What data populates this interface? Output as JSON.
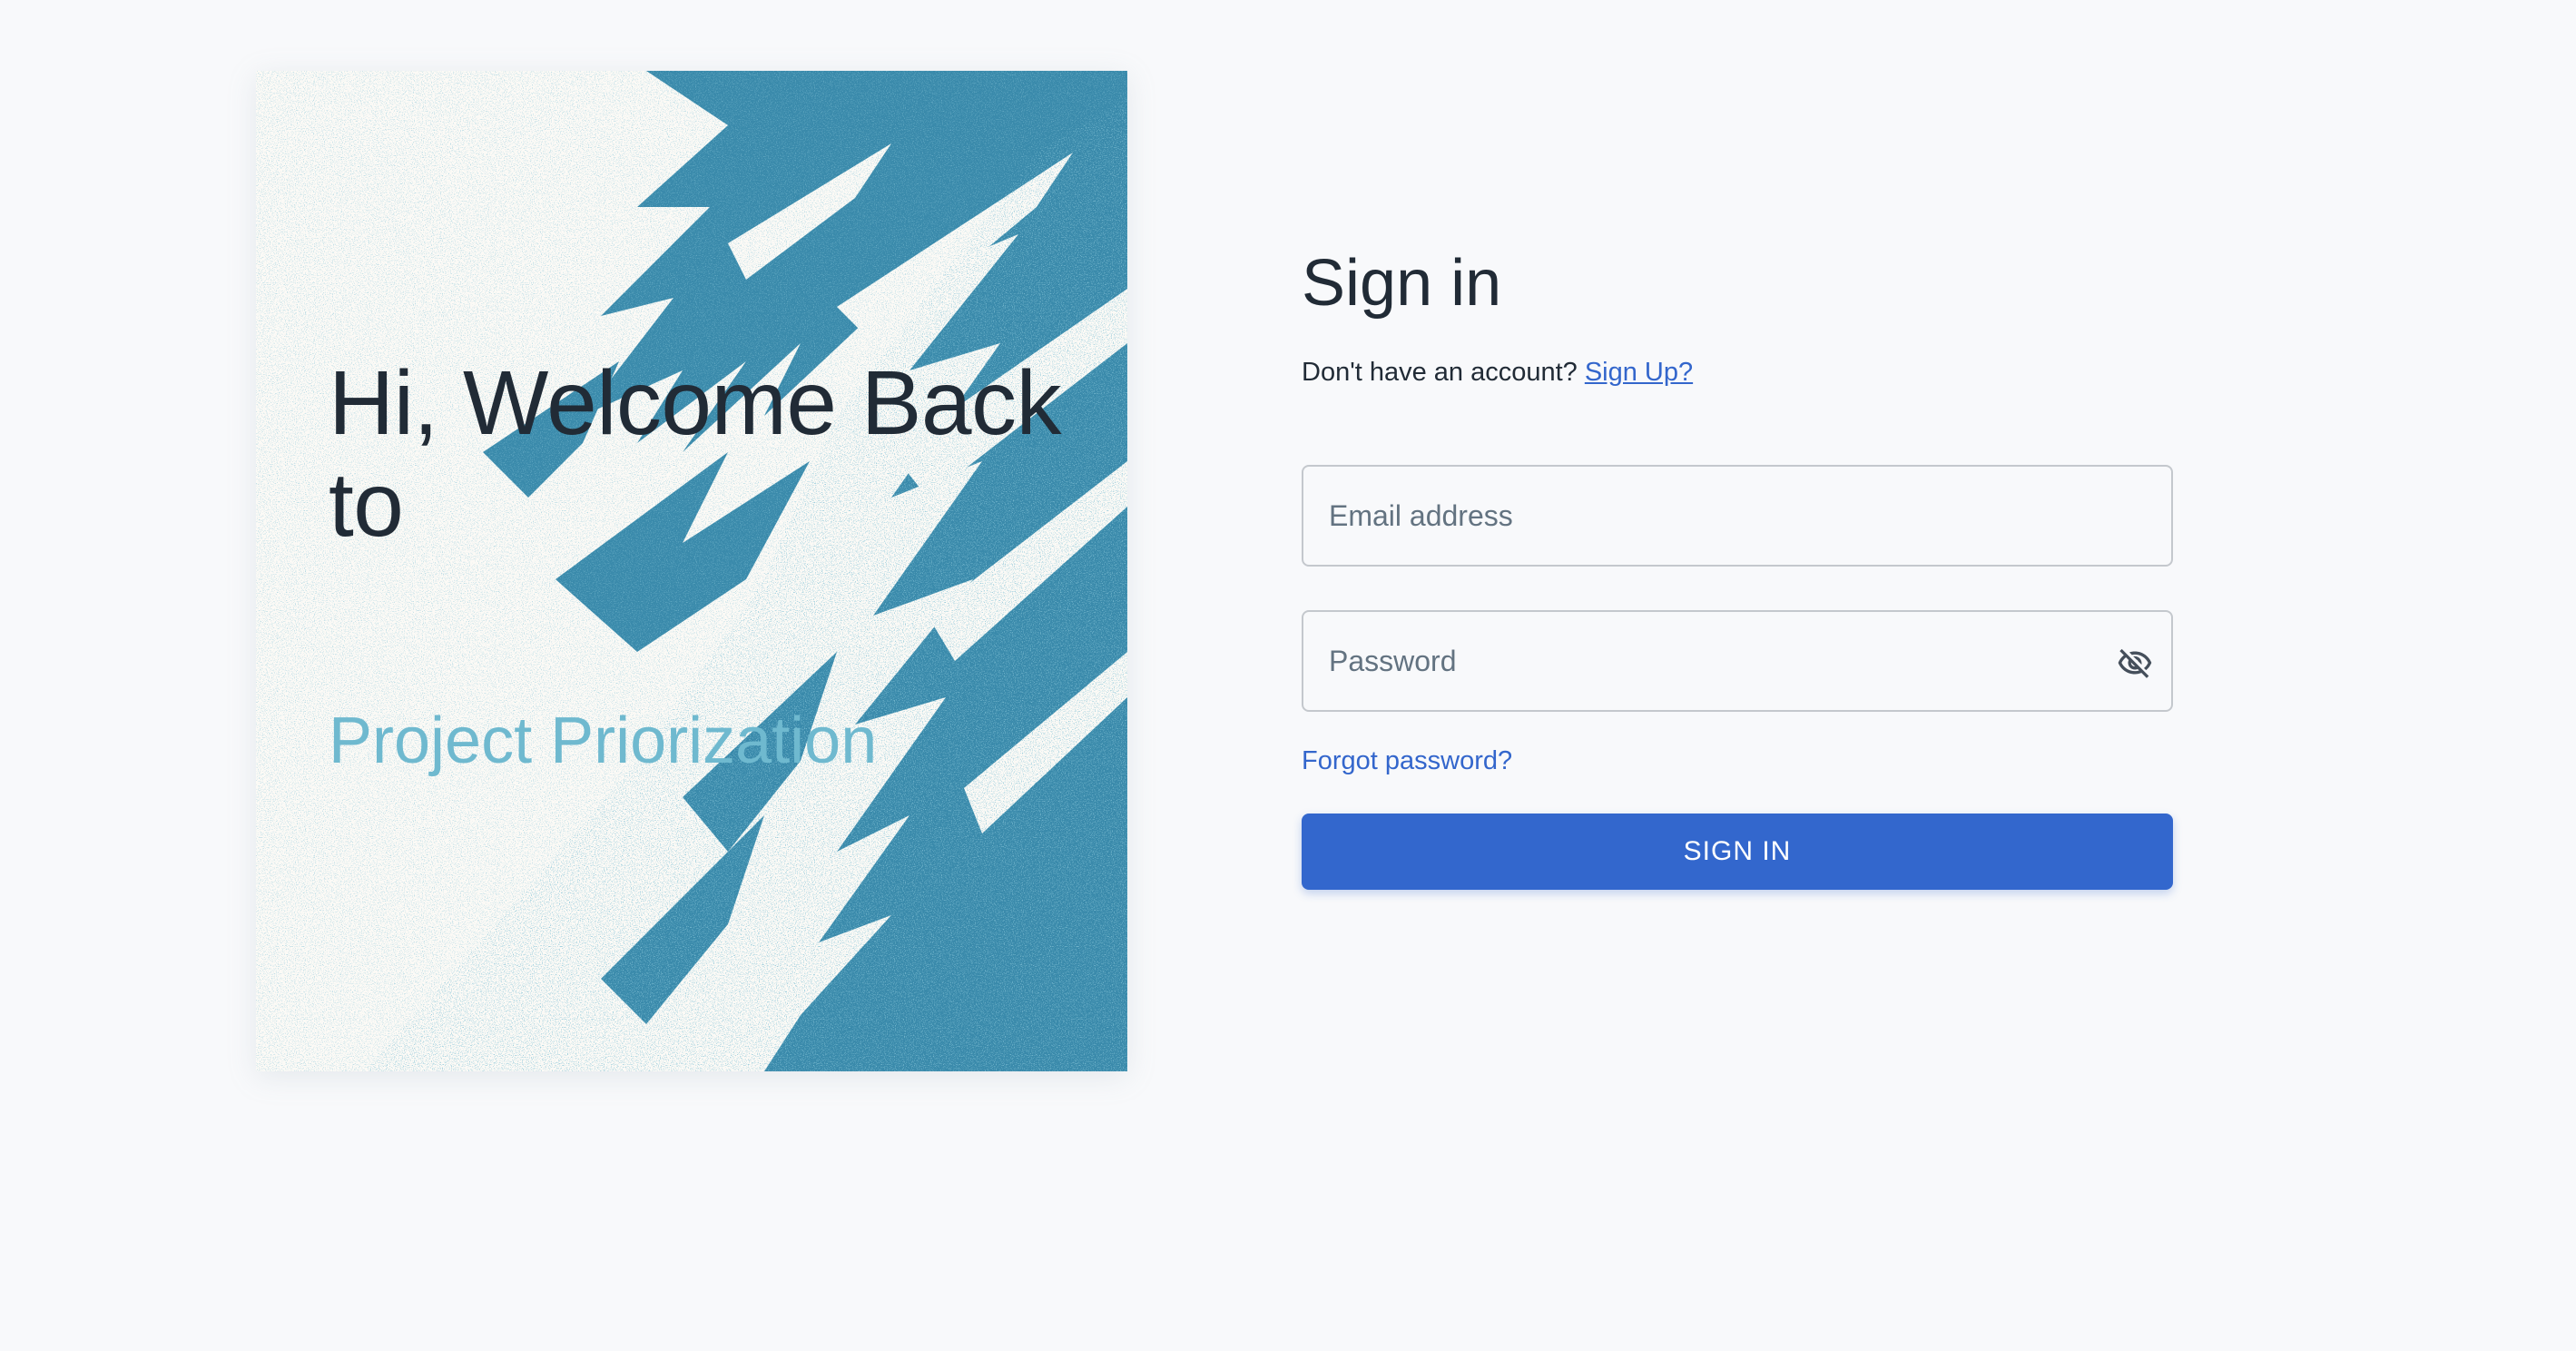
{
  "hero": {
    "title": "Hi, Welcome Back to",
    "subtitle": "Project Priorization"
  },
  "signin": {
    "title": "Sign in",
    "no_account_text": "Don't have an account?",
    "signup_link": "Sign Up?",
    "email_placeholder": "Email address",
    "password_placeholder": "Password",
    "password_toggle_icon": "eye-off-icon",
    "forgot_password": "Forgot password?",
    "submit_label": "SIGN IN"
  },
  "colors": {
    "background": "#f8f9fb",
    "accent_blue": "#3367cd",
    "link_blue": "#3366cc",
    "hero_paint": "#3a8aab",
    "hero_subtitle": "#6fb9cf",
    "text_primary": "#212b36"
  }
}
